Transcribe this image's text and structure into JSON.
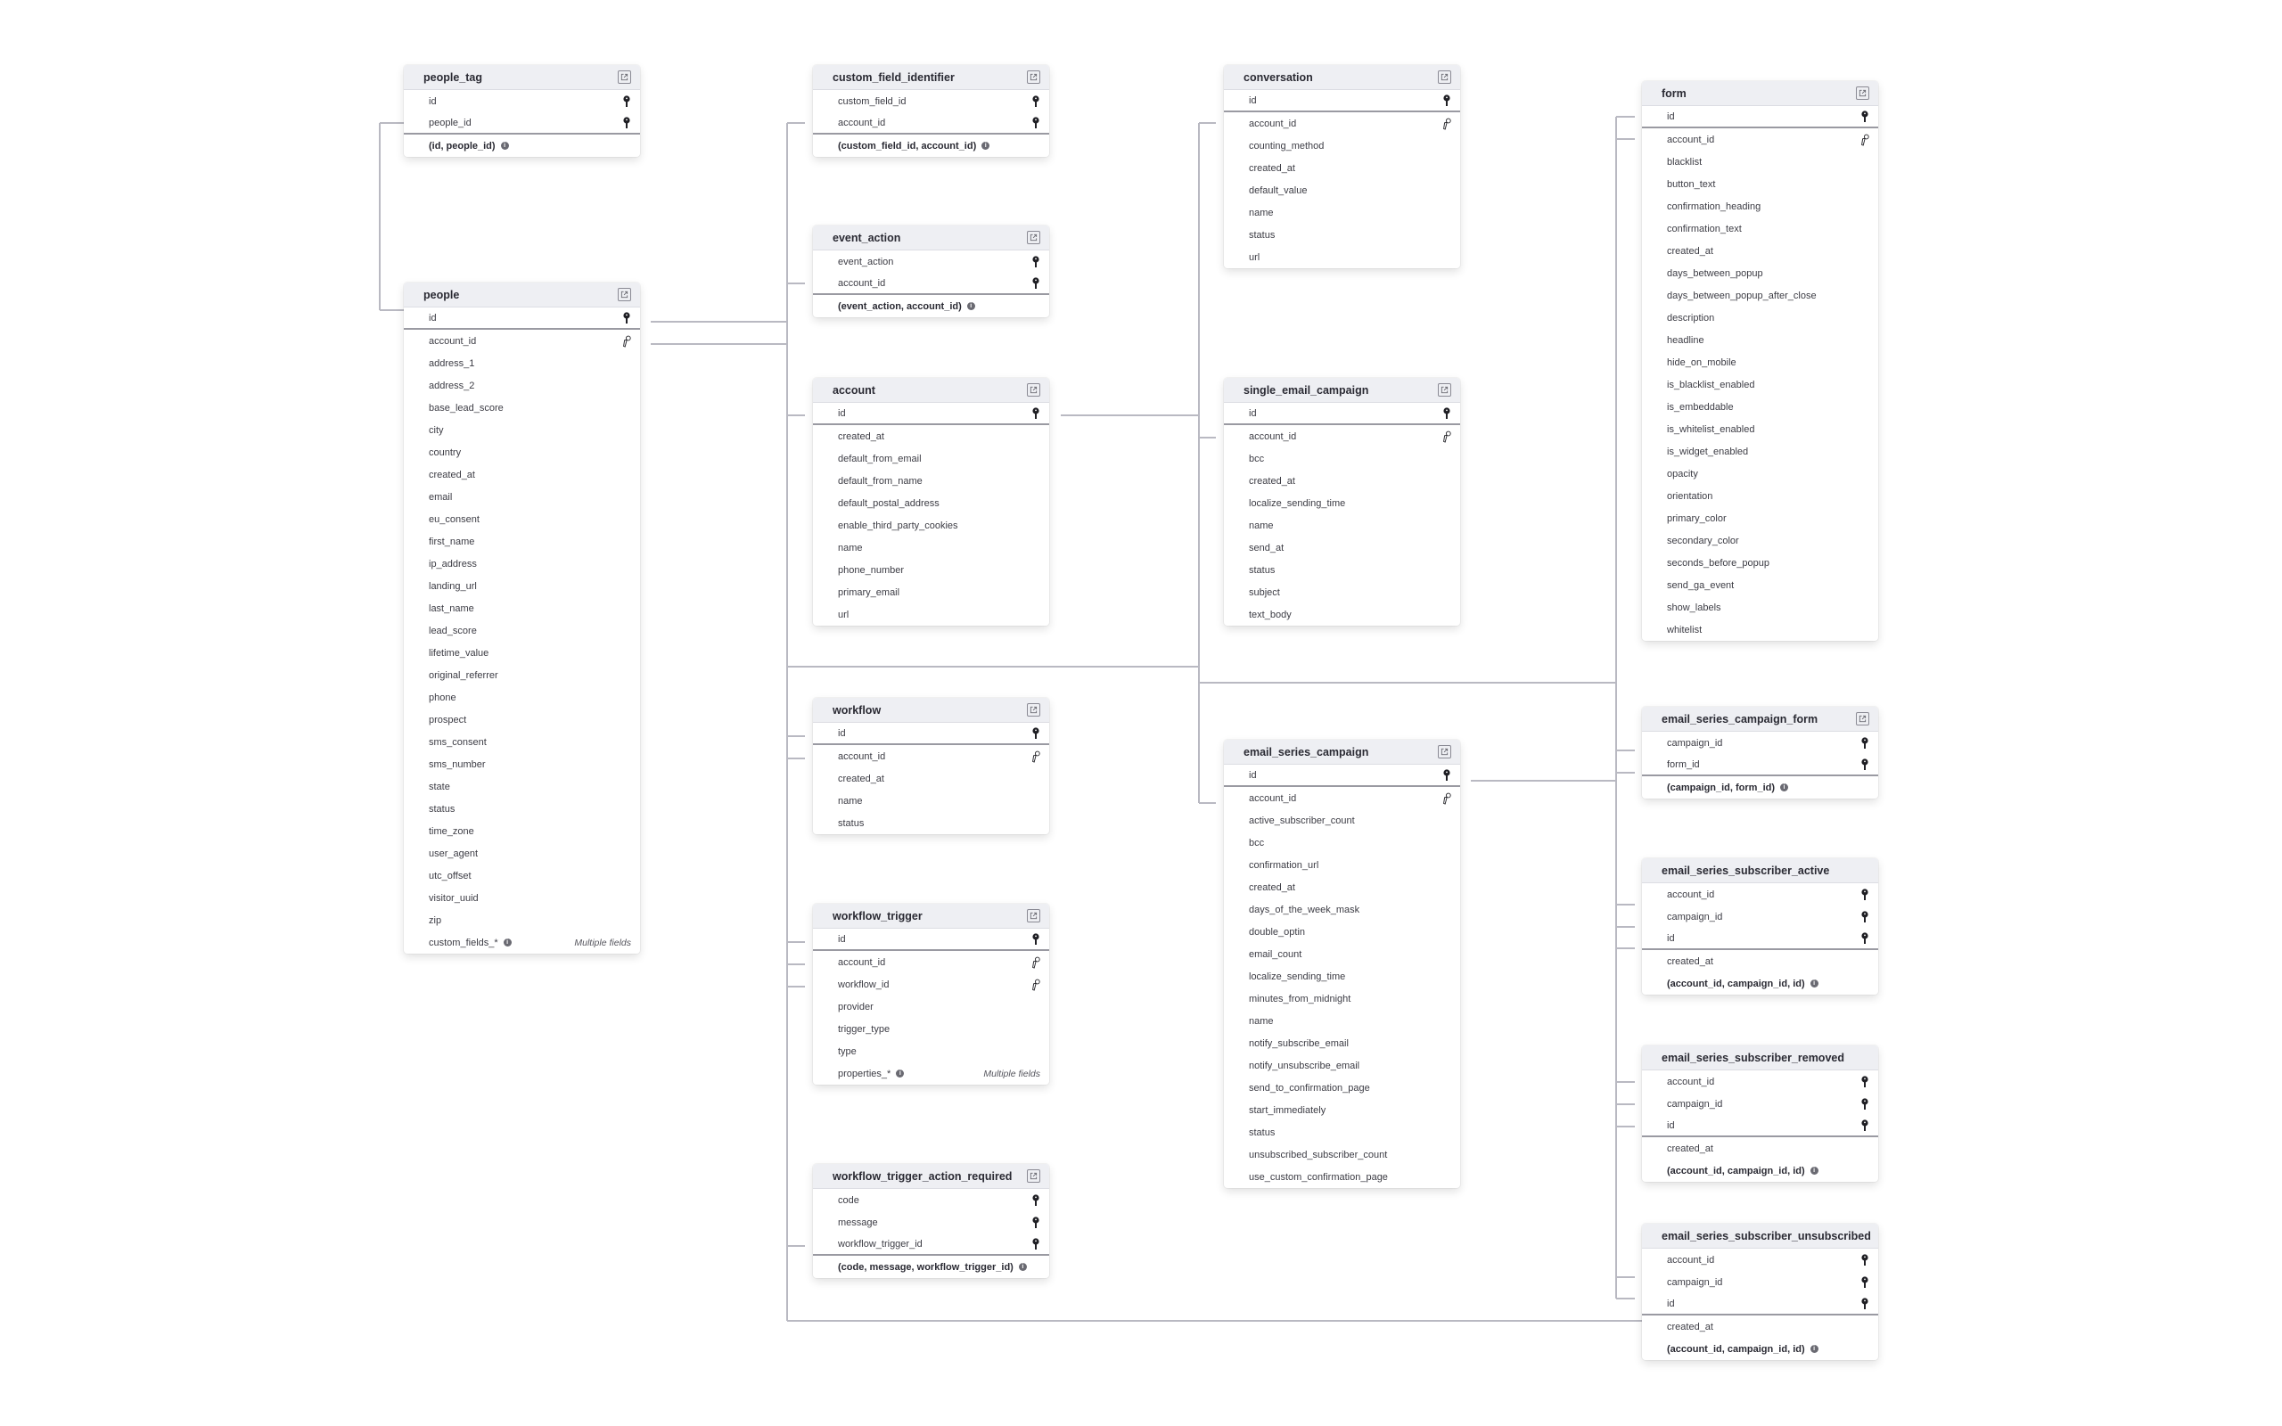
{
  "tables": [
    {
      "id": "people_tag",
      "name": "people_tag",
      "link": true,
      "fields": [
        {
          "name": "id",
          "key": "pk"
        },
        {
          "name": "people_id",
          "key": "pk"
        }
      ],
      "pk_count": 2,
      "index": "(id, people_id)"
    },
    {
      "id": "people",
      "name": "people",
      "link": true,
      "fields": [
        {
          "name": "id",
          "key": "pk"
        },
        {
          "name": "account_id",
          "key": "fk"
        },
        {
          "name": "address_1"
        },
        {
          "name": "address_2"
        },
        {
          "name": "base_lead_score"
        },
        {
          "name": "city"
        },
        {
          "name": "country"
        },
        {
          "name": "created_at"
        },
        {
          "name": "email"
        },
        {
          "name": "eu_consent"
        },
        {
          "name": "first_name"
        },
        {
          "name": "ip_address"
        },
        {
          "name": "landing_url"
        },
        {
          "name": "last_name"
        },
        {
          "name": "lead_score"
        },
        {
          "name": "lifetime_value"
        },
        {
          "name": "original_referrer"
        },
        {
          "name": "phone"
        },
        {
          "name": "prospect"
        },
        {
          "name": "sms_consent"
        },
        {
          "name": "sms_number"
        },
        {
          "name": "state"
        },
        {
          "name": "status"
        },
        {
          "name": "time_zone"
        },
        {
          "name": "user_agent"
        },
        {
          "name": "utc_offset"
        },
        {
          "name": "visitor_uuid"
        },
        {
          "name": "zip"
        },
        {
          "name": "custom_fields_*",
          "info": true,
          "note": "Multiple fields"
        }
      ],
      "pk_count": 1
    },
    {
      "id": "custom_field_identifier",
      "name": "custom_field_identifier",
      "link": true,
      "fields": [
        {
          "name": "custom_field_id",
          "key": "pk"
        },
        {
          "name": "account_id",
          "key": "pk"
        }
      ],
      "pk_count": 2,
      "index": "(custom_field_id, account_id)"
    },
    {
      "id": "event_action",
      "name": "event_action",
      "link": true,
      "fields": [
        {
          "name": "event_action",
          "key": "pk"
        },
        {
          "name": "account_id",
          "key": "pk"
        }
      ],
      "pk_count": 2,
      "index": "(event_action, account_id)"
    },
    {
      "id": "account",
      "name": "account",
      "link": true,
      "fields": [
        {
          "name": "id",
          "key": "pk"
        },
        {
          "name": "created_at"
        },
        {
          "name": "default_from_email"
        },
        {
          "name": "default_from_name"
        },
        {
          "name": "default_postal_address"
        },
        {
          "name": "enable_third_party_cookies"
        },
        {
          "name": "name"
        },
        {
          "name": "phone_number"
        },
        {
          "name": "primary_email"
        },
        {
          "name": "url"
        }
      ],
      "pk_count": 1
    },
    {
      "id": "workflow",
      "name": "workflow",
      "link": true,
      "fields": [
        {
          "name": "id",
          "key": "pk"
        },
        {
          "name": "account_id",
          "key": "fk"
        },
        {
          "name": "created_at"
        },
        {
          "name": "name"
        },
        {
          "name": "status"
        }
      ],
      "pk_count": 1
    },
    {
      "id": "workflow_trigger",
      "name": "workflow_trigger",
      "link": true,
      "fields": [
        {
          "name": "id",
          "key": "pk"
        },
        {
          "name": "account_id",
          "key": "fk"
        },
        {
          "name": "workflow_id",
          "key": "fk"
        },
        {
          "name": "provider"
        },
        {
          "name": "trigger_type"
        },
        {
          "name": "type"
        },
        {
          "name": "properties_*",
          "info": true,
          "note": "Multiple fields"
        }
      ],
      "pk_count": 1
    },
    {
      "id": "workflow_trigger_action_required",
      "name": "workflow_trigger_action_required",
      "link": true,
      "fields": [
        {
          "name": "code",
          "key": "pk"
        },
        {
          "name": "message",
          "key": "pk"
        },
        {
          "name": "workflow_trigger_id",
          "key": "pk"
        }
      ],
      "pk_count": 3,
      "index": "(code, message, workflow_trigger_id)"
    },
    {
      "id": "conversation",
      "name": "conversation",
      "link": true,
      "fields": [
        {
          "name": "id",
          "key": "pk"
        },
        {
          "name": "account_id",
          "key": "fk"
        },
        {
          "name": "counting_method"
        },
        {
          "name": "created_at"
        },
        {
          "name": "default_value"
        },
        {
          "name": "name"
        },
        {
          "name": "status"
        },
        {
          "name": "url"
        }
      ],
      "pk_count": 1
    },
    {
      "id": "single_email_campaign",
      "name": "single_email_campaign",
      "link": true,
      "fields": [
        {
          "name": "id",
          "key": "pk"
        },
        {
          "name": "account_id",
          "key": "fk"
        },
        {
          "name": "bcc"
        },
        {
          "name": "created_at"
        },
        {
          "name": "localize_sending_time"
        },
        {
          "name": "name"
        },
        {
          "name": "send_at"
        },
        {
          "name": "status"
        },
        {
          "name": "subject"
        },
        {
          "name": "text_body"
        }
      ],
      "pk_count": 1
    },
    {
      "id": "email_series_campaign",
      "name": "email_series_campaign",
      "link": true,
      "fields": [
        {
          "name": "id",
          "key": "pk"
        },
        {
          "name": "account_id",
          "key": "fk"
        },
        {
          "name": "active_subscriber_count"
        },
        {
          "name": "bcc"
        },
        {
          "name": "confirmation_url"
        },
        {
          "name": "created_at"
        },
        {
          "name": "days_of_the_week_mask"
        },
        {
          "name": "double_optin"
        },
        {
          "name": "email_count"
        },
        {
          "name": "localize_sending_time"
        },
        {
          "name": "minutes_from_midnight"
        },
        {
          "name": "name"
        },
        {
          "name": "notify_subscribe_email"
        },
        {
          "name": "notify_unsubscribe_email"
        },
        {
          "name": "send_to_confirmation_page"
        },
        {
          "name": "start_immediately"
        },
        {
          "name": "status"
        },
        {
          "name": "unsubscribed_subscriber_count"
        },
        {
          "name": "use_custom_confirmation_page"
        }
      ],
      "pk_count": 1
    },
    {
      "id": "form",
      "name": "form",
      "link": true,
      "fields": [
        {
          "name": "id",
          "key": "pk"
        },
        {
          "name": "account_id",
          "key": "fk"
        },
        {
          "name": "blacklist"
        },
        {
          "name": "button_text"
        },
        {
          "name": "confirmation_heading"
        },
        {
          "name": "confirmation_text"
        },
        {
          "name": "created_at"
        },
        {
          "name": "days_between_popup"
        },
        {
          "name": "days_between_popup_after_close"
        },
        {
          "name": "description"
        },
        {
          "name": "headline"
        },
        {
          "name": "hide_on_mobile"
        },
        {
          "name": "is_blacklist_enabled"
        },
        {
          "name": "is_embeddable"
        },
        {
          "name": "is_whitelist_enabled"
        },
        {
          "name": "is_widget_enabled"
        },
        {
          "name": "opacity"
        },
        {
          "name": "orientation"
        },
        {
          "name": "primary_color"
        },
        {
          "name": "secondary_color"
        },
        {
          "name": "seconds_before_popup"
        },
        {
          "name": "send_ga_event"
        },
        {
          "name": "show_labels"
        },
        {
          "name": "whitelist"
        }
      ],
      "pk_count": 1
    },
    {
      "id": "email_series_campaign_form",
      "name": "email_series_campaign_form",
      "link": true,
      "fields": [
        {
          "name": "campaign_id",
          "key": "pk"
        },
        {
          "name": "form_id",
          "key": "pk"
        }
      ],
      "pk_count": 2,
      "index": "(campaign_id, form_id)"
    },
    {
      "id": "email_series_subscriber_active",
      "name": "email_series_subscriber_active",
      "link": false,
      "fields": [
        {
          "name": "account_id",
          "key": "pk"
        },
        {
          "name": "campaign_id",
          "key": "pk"
        },
        {
          "name": "id",
          "key": "pk"
        },
        {
          "name": "created_at"
        }
      ],
      "pk_count": 3,
      "index": "(account_id, campaign_id, id)"
    },
    {
      "id": "email_series_subscriber_removed",
      "name": "email_series_subscriber_removed",
      "link": false,
      "fields": [
        {
          "name": "account_id",
          "key": "pk"
        },
        {
          "name": "campaign_id",
          "key": "pk"
        },
        {
          "name": "id",
          "key": "pk"
        },
        {
          "name": "created_at"
        }
      ],
      "pk_count": 3,
      "index": "(account_id, campaign_id, id)"
    },
    {
      "id": "email_series_subscriber_unsubscribed",
      "name": "email_series_subscriber_unsubscribed",
      "link": false,
      "fields": [
        {
          "name": "account_id",
          "key": "pk"
        },
        {
          "name": "campaign_id",
          "key": "pk"
        },
        {
          "name": "id",
          "key": "pk"
        },
        {
          "name": "created_at"
        }
      ],
      "pk_count": 3,
      "index": "(account_id, campaign_id, id)"
    }
  ]
}
